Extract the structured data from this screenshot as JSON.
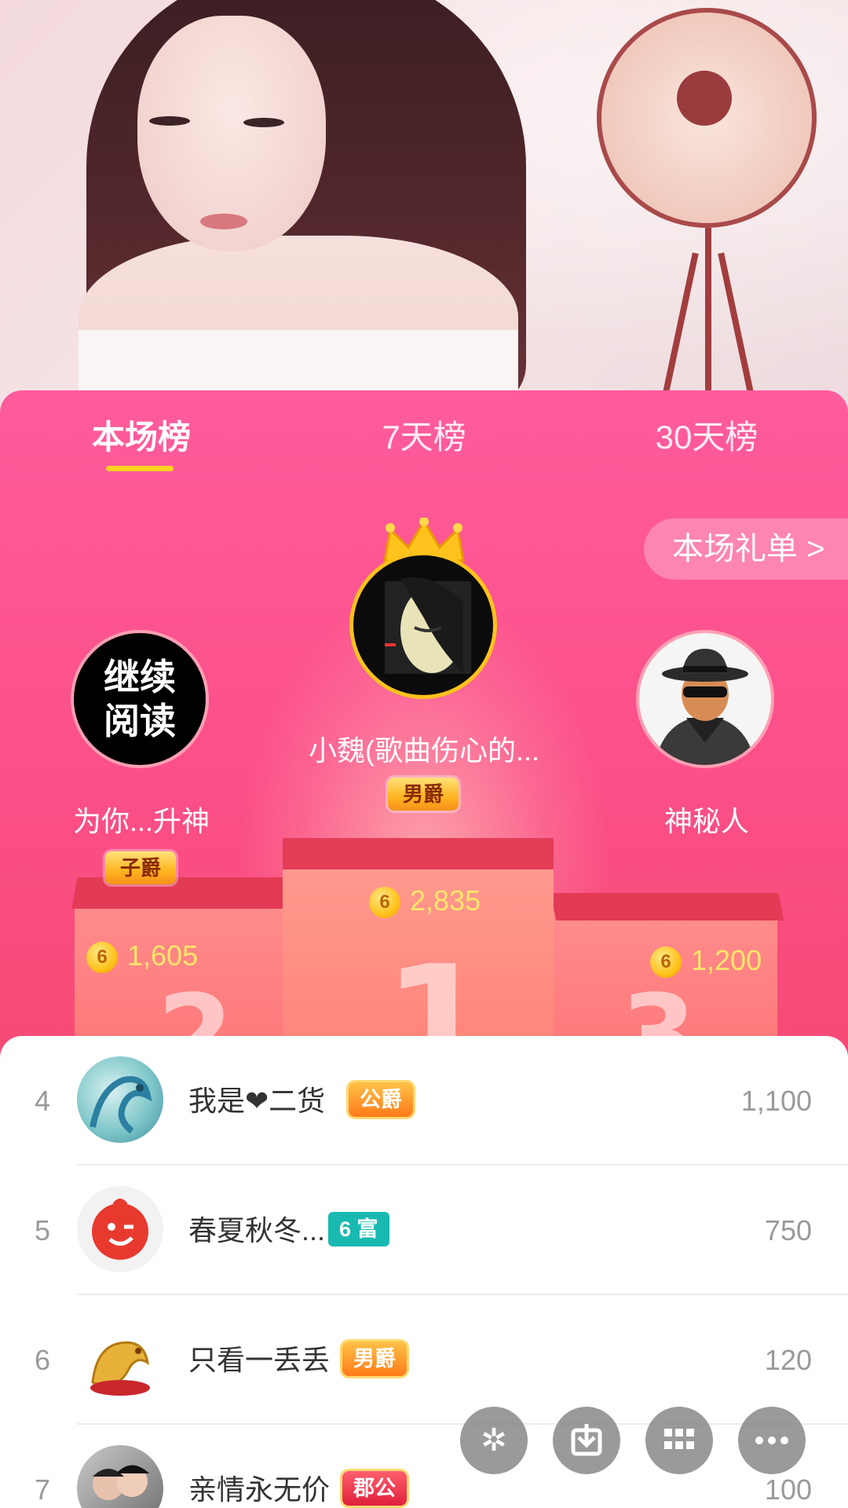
{
  "tabs": [
    "本场榜",
    "7天榜",
    "30天榜"
  ],
  "gift_list_label": "本场礼单 >",
  "podium": {
    "first": {
      "name": "小魏(歌曲伤心的...",
      "title": "男爵",
      "coins": "2,835",
      "avatar_icon": "woman-portrait-icon"
    },
    "second": {
      "name": "为你...升神",
      "title": "子爵",
      "coins": "1,605",
      "avatar_text": "继续\n阅读"
    },
    "third": {
      "name": "神秘人",
      "coins": "1,200",
      "avatar_icon": "mystery-man-icon"
    },
    "numbers": [
      "1",
      "2",
      "3"
    ]
  },
  "coin_symbol": "6",
  "list": [
    {
      "rank": "4",
      "name": "我是❤二货",
      "badge": "公爵",
      "value": "1,100"
    },
    {
      "rank": "5",
      "name": "春夏秋冬...",
      "badge": "6 富",
      "value": "750"
    },
    {
      "rank": "6",
      "name": "只看一丢丢",
      "badge": "男爵",
      "value": "120"
    },
    {
      "rank": "7",
      "name": "亲情永无价",
      "badge": "郡公",
      "value": "100"
    }
  ],
  "colors": {
    "panel_top": "#ff5c9c",
    "panel_bottom": "#f0485c",
    "tab_underline": "#ffd21f",
    "coin_text": "#ffe66a"
  },
  "fab_icons": [
    "sparkle-icon",
    "download-icon",
    "grid-icon",
    "more-icon"
  ]
}
